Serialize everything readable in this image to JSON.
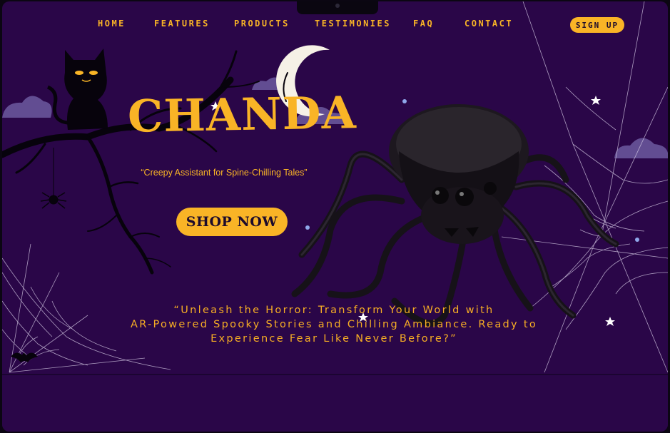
{
  "nav": {
    "items": [
      "Home",
      "Features",
      "Products",
      "Testimonies",
      "FAQ",
      "Contact"
    ],
    "signup_label": "Sign up"
  },
  "hero": {
    "brand": "CHANDA",
    "tagline": "“Creepy Assistant for Spine-Chilling Tales”",
    "cta_label": "SHOP NOW",
    "description_lines": [
      "“Unleash the Horror: Transform Your World with",
      "AR-Powered Spooky Stories and Chilling Ambiance. Ready to",
      "Experience Fear Like Never Before?”"
    ]
  },
  "colors": {
    "background": "#2a0648",
    "accent": "#f9b426",
    "cloud": "#6c5aa0",
    "web": "#d9cfe8"
  },
  "icons": [
    "cat-icon",
    "moon-icon",
    "spider-speaker-icon",
    "spider-web-icon",
    "star-icon",
    "bat-icon"
  ]
}
